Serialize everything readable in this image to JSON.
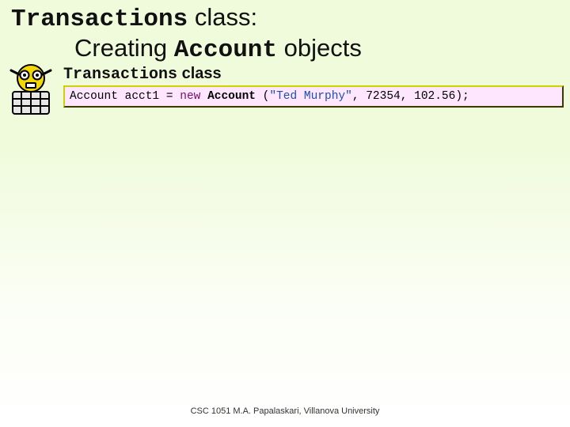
{
  "title": {
    "line1_mono": "Transactions",
    "line1_sans": " class:",
    "line2_sans_a": "Creating ",
    "line2_mono": "Account",
    "line2_sans_b": " objects"
  },
  "section": {
    "mono": "Transactions",
    "sans": " class"
  },
  "code": {
    "type_decl": "Account",
    "var_eq": " acct1 = ",
    "kw_new": "new",
    "space1": " ",
    "ctor": "Account",
    "paren_open": " (",
    "str_lit": "\"Ted Murphy\"",
    "args_rest": ", 72354, 102.56);"
  },
  "footer": "CSC 1051 M.A. Papalaskari, Villanova University",
  "icons": {
    "robot": "robot-icon"
  }
}
